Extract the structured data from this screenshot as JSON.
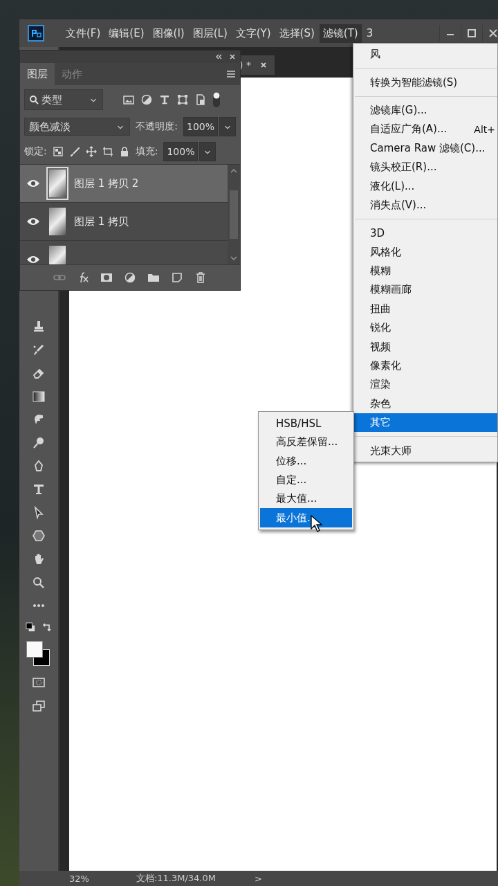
{
  "window": {
    "menu": [
      {
        "label": "文件(F)",
        "selected": false
      },
      {
        "label": "编辑(E)",
        "selected": false
      },
      {
        "label": "图像(I)",
        "selected": false
      },
      {
        "label": "图层(L)",
        "selected": false
      },
      {
        "label": "文字(Y)",
        "selected": false
      },
      {
        "label": "选择(S)",
        "selected": false
      },
      {
        "label": "滤镜(T)",
        "selected": true
      },
      {
        "label": "3",
        "selected": false
      }
    ]
  },
  "document_tab": {
    "title": ") *"
  },
  "layers_panel": {
    "tabs": [
      {
        "label": "图层",
        "selected": true
      },
      {
        "label": "动作",
        "selected": false
      }
    ],
    "filter": "类型",
    "blend_mode": "颜色减淡",
    "opacity_label": "不透明度:",
    "opacity": "100%",
    "lock_label": "锁定:",
    "fill_label": "填充:",
    "fill": "100%",
    "layers": [
      {
        "name": "图层 1 拷贝 2",
        "visible": true,
        "selected": true
      },
      {
        "name": "图层 1 拷贝",
        "visible": true,
        "selected": false
      },
      {
        "visible": true,
        "selected": false
      }
    ]
  },
  "filter_menu": {
    "groups": [
      [
        {
          "label": "风",
          "selected": false
        }
      ],
      [
        {
          "label": "转换为智能滤镜(S)",
          "selected": false
        }
      ],
      [
        {
          "label": "滤镜库(G)...",
          "selected": false
        },
        {
          "label": "自适应广角(A)...",
          "shortcut": "Alt+",
          "selected": false
        },
        {
          "label": "Camera Raw 滤镜(C)...",
          "selected": false
        },
        {
          "label": "镜头校正(R)...",
          "selected": false
        },
        {
          "label": "液化(L)...",
          "selected": false
        },
        {
          "label": "消失点(V)...",
          "selected": false
        }
      ],
      [
        {
          "label": "3D",
          "selected": false
        },
        {
          "label": "风格化",
          "selected": false
        },
        {
          "label": "模糊",
          "selected": false
        },
        {
          "label": "模糊画廊",
          "selected": false
        },
        {
          "label": "扭曲",
          "selected": false
        },
        {
          "label": "锐化",
          "selected": false
        },
        {
          "label": "视频",
          "selected": false
        },
        {
          "label": "像素化",
          "selected": false
        },
        {
          "label": "渲染",
          "selected": false
        },
        {
          "label": "杂色",
          "selected": false
        },
        {
          "label": "其它",
          "selected": true
        }
      ],
      [
        {
          "label": "光束大师",
          "selected": false
        }
      ]
    ]
  },
  "submenu": {
    "items": [
      {
        "label": "HSB/HSL",
        "selected": false
      },
      {
        "label": "高反差保留...",
        "selected": false
      },
      {
        "label": "位移...",
        "selected": false
      },
      {
        "label": "自定...",
        "selected": false
      },
      {
        "label": "最大值...",
        "selected": false
      },
      {
        "label": "最小值.",
        "selected": true
      }
    ]
  },
  "status_bar": {
    "zoom": "32%",
    "document": "文档:11.3M/34.0M",
    "arrow": ">"
  }
}
